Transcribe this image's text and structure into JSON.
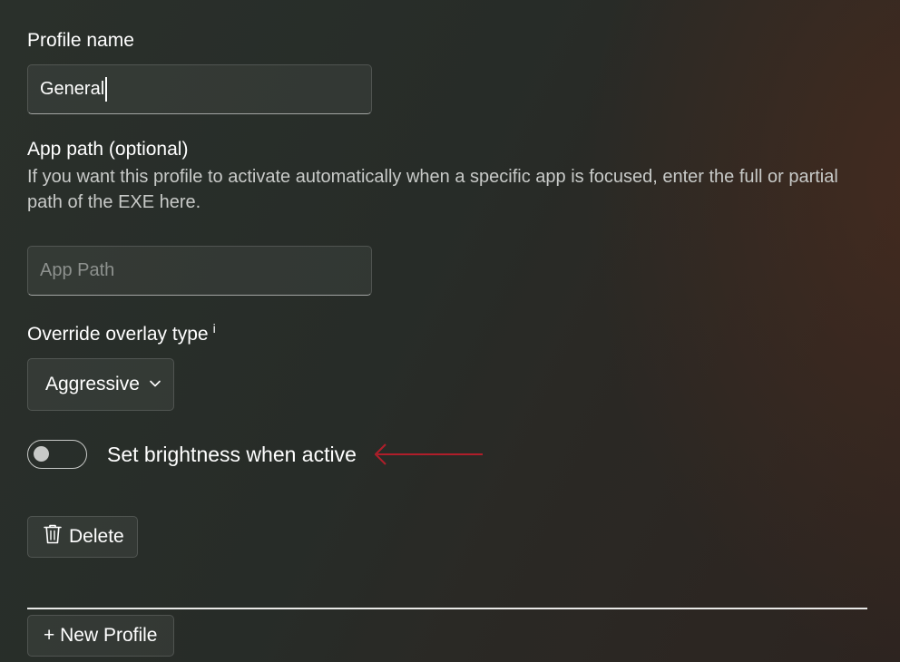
{
  "profile_name": {
    "label": "Profile name",
    "value": "General"
  },
  "app_path": {
    "label": "App path (optional)",
    "description": "If you want this profile to activate automatically when a specific app is focused, enter the full or partial path of the EXE here.",
    "value": "",
    "placeholder": "App Path"
  },
  "overlay": {
    "label": "Override overlay type",
    "info_marker": "i",
    "selected": "Aggressive"
  },
  "brightness_toggle": {
    "label": "Set brightness when active",
    "state": "off"
  },
  "annotation": {
    "arrow_color": "#b01e2a"
  },
  "buttons": {
    "delete": "Delete",
    "new_profile": "+ New Profile"
  },
  "icons": {
    "delete": "trash-icon",
    "dropdown": "chevron-down-icon"
  }
}
